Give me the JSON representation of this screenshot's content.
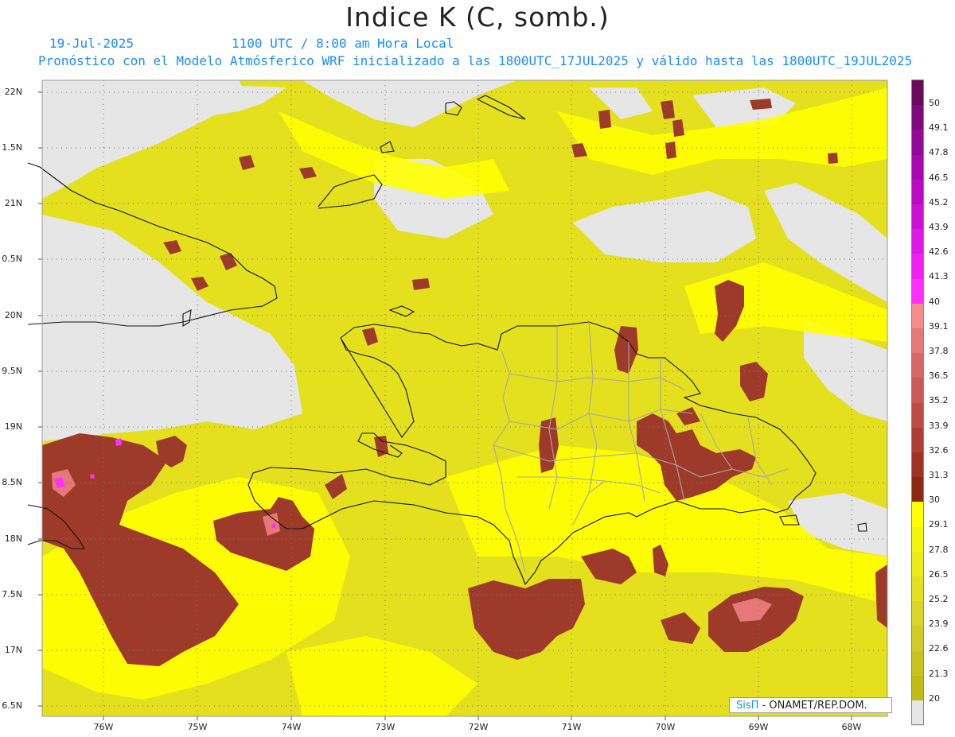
{
  "title": "Indice K (C, somb.)",
  "date": "19-Jul-2025",
  "time": "1100 UTC / 8:00 am Hora Local",
  "description": "Pronóstico con el Modelo Atmósferico WRF inicializado a las 1800UTC_17JUL2025 y válido hasta las  1800UTC_19JUL2025",
  "lat_labels": [
    "22N",
    "1.5N",
    "21N",
    "0.5N",
    "20N",
    "9.5N",
    "19N",
    "8.5N",
    "18N",
    "7.5N",
    "17N",
    "6.5N"
  ],
  "lon_labels": [
    "76W",
    "75W",
    "74W",
    "73W",
    "72W",
    "71W",
    "70W",
    "69W",
    "68W"
  ],
  "colorbar": [
    {
      "label": "50",
      "color": "#6a0a5a"
    },
    {
      "label": "49.1",
      "color": "#7e0a7e"
    },
    {
      "label": "47.8",
      "color": "#920a96"
    },
    {
      "label": "46.5",
      "color": "#a60aae"
    },
    {
      "label": "45.2",
      "color": "#ba0ac4"
    },
    {
      "label": "43.9",
      "color": "#cc10d6"
    },
    {
      "label": "42.6",
      "color": "#de18e6"
    },
    {
      "label": "41.3",
      "color": "#f020f2"
    },
    {
      "label": "40",
      "color": "#ff30ff"
    },
    {
      "label": "39.1",
      "color": "#f48c8c"
    },
    {
      "label": "37.8",
      "color": "#e67878"
    },
    {
      "label": "36.5",
      "color": "#d86868"
    },
    {
      "label": "35.2",
      "color": "#ca5a54"
    },
    {
      "label": "33.9",
      "color": "#bc4c44"
    },
    {
      "label": "32.6",
      "color": "#ae3e34"
    },
    {
      "label": "31.3",
      "color": "#a03224"
    },
    {
      "label": "30",
      "color": "#8a2a10"
    },
    {
      "label": "29.1",
      "color": "#ffff00"
    },
    {
      "label": "27.8",
      "color": "#f6f40a"
    },
    {
      "label": "26.5",
      "color": "#eeea14"
    },
    {
      "label": "25.2",
      "color": "#e4e01e"
    },
    {
      "label": "23.9",
      "color": "#dad628"
    },
    {
      "label": "22.6",
      "color": "#d0cc28"
    },
    {
      "label": "21.3",
      "color": "#c8c41e"
    },
    {
      "label": "20",
      "color": "#c0bc14"
    },
    {
      "label": "",
      "color": "#e6e6e6"
    }
  ],
  "credit_brand": "SisΠ",
  "credit_text": " - ONAMET/REP.DOM."
}
